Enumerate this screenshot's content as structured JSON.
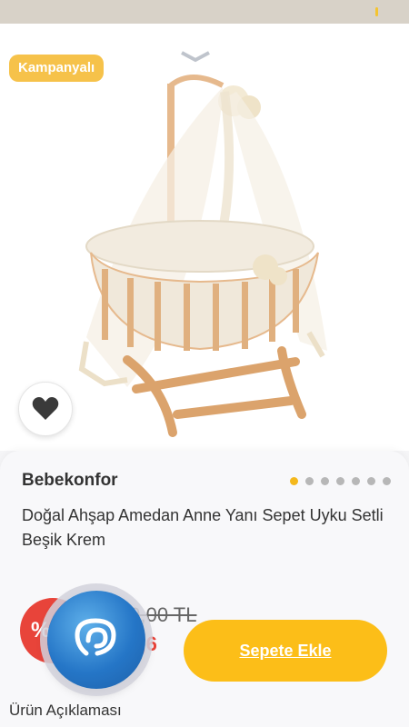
{
  "status_bar": {
    "accent_color": "#f4c430"
  },
  "product": {
    "campaign_badge": "Kampanyalı",
    "brand": "Bebekonfor",
    "title": "Doğal Ahşap Amedan Anne Yanı Sepet Uyku Setli Beşik Krem",
    "image_pages": {
      "total": 7,
      "active": 1
    },
    "old_price": "99,00 TL",
    "new_price": "66,6",
    "discount_icon": "%",
    "favorite_icon": "heart-icon"
  },
  "actions": {
    "add_to_cart": "Sepete Ekle",
    "support_icon": "support-chat-icon"
  },
  "tabs": {
    "description": "Ürün Açıklaması"
  },
  "colors": {
    "accent": "#fcbe18",
    "discount": "#e8443a",
    "badge": "#f6c24a"
  }
}
